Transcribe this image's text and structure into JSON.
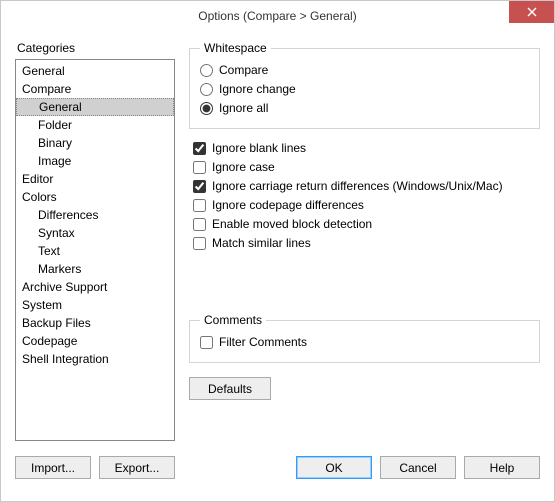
{
  "window": {
    "title": "Options (Compare > General)",
    "close_label": "Close"
  },
  "categories": {
    "label": "Categories",
    "items": [
      {
        "label": "General",
        "level": 0,
        "selected": false
      },
      {
        "label": "Compare",
        "level": 0,
        "selected": false
      },
      {
        "label": "General",
        "level": 1,
        "selected": true
      },
      {
        "label": "Folder",
        "level": 1,
        "selected": false
      },
      {
        "label": "Binary",
        "level": 1,
        "selected": false
      },
      {
        "label": "Image",
        "level": 1,
        "selected": false
      },
      {
        "label": "Editor",
        "level": 0,
        "selected": false
      },
      {
        "label": "Colors",
        "level": 0,
        "selected": false
      },
      {
        "label": "Differences",
        "level": 1,
        "selected": false
      },
      {
        "label": "Syntax",
        "level": 1,
        "selected": false
      },
      {
        "label": "Text",
        "level": 1,
        "selected": false
      },
      {
        "label": "Markers",
        "level": 1,
        "selected": false
      },
      {
        "label": "Archive Support",
        "level": 0,
        "selected": false
      },
      {
        "label": "System",
        "level": 0,
        "selected": false
      },
      {
        "label": "Backup Files",
        "level": 0,
        "selected": false
      },
      {
        "label": "Codepage",
        "level": 0,
        "selected": false
      },
      {
        "label": "Shell Integration",
        "level": 0,
        "selected": false
      }
    ]
  },
  "whitespace": {
    "legend": "Whitespace",
    "options": [
      {
        "label": "Compare",
        "checked": false
      },
      {
        "label": "Ignore change",
        "checked": false
      },
      {
        "label": "Ignore all",
        "checked": true
      }
    ]
  },
  "main_options": [
    {
      "label": "Ignore blank lines",
      "checked": true
    },
    {
      "label": "Ignore case",
      "checked": false
    },
    {
      "label": "Ignore carriage return differences (Windows/Unix/Mac)",
      "checked": true
    },
    {
      "label": "Ignore codepage differences",
      "checked": false
    },
    {
      "label": "Enable moved block detection",
      "checked": false
    },
    {
      "label": "Match similar lines",
      "checked": false
    }
  ],
  "comments": {
    "legend": "Comments",
    "option": {
      "label": "Filter Comments",
      "checked": false
    }
  },
  "buttons": {
    "defaults": "Defaults",
    "import": "Import...",
    "export": "Export...",
    "ok": "OK",
    "cancel": "Cancel",
    "help": "Help"
  }
}
